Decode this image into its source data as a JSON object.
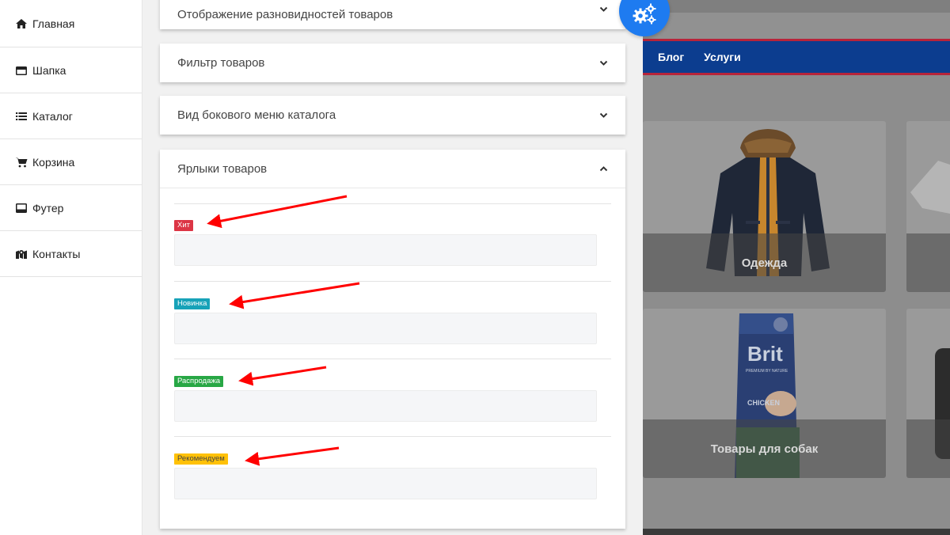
{
  "sidebar": {
    "items": [
      {
        "label": "Главная",
        "icon": "home-icon"
      },
      {
        "label": "Шапка",
        "icon": "window-icon"
      },
      {
        "label": "Каталог",
        "icon": "list-icon"
      },
      {
        "label": "Корзина",
        "icon": "cart-icon"
      },
      {
        "label": "Футер",
        "icon": "footer-icon"
      },
      {
        "label": "Контакты",
        "icon": "map-icon"
      }
    ]
  },
  "settings": {
    "sections": [
      {
        "title": "Отображение разновидностей товаров",
        "expanded": false
      },
      {
        "title": "Фильтр товаров",
        "expanded": false
      },
      {
        "title": "Вид бокового меню каталога",
        "expanded": false
      },
      {
        "title": "Ярлыки товаров",
        "expanded": true
      }
    ],
    "labels": [
      {
        "text": "Хит",
        "color": "#dc3545",
        "value": ""
      },
      {
        "text": "Новинка",
        "color": "#17a2b8",
        "value": ""
      },
      {
        "text": "Распродажа",
        "color": "#28a745",
        "value": ""
      },
      {
        "text": "Рекомендуем",
        "color": "#ffc107",
        "value": ""
      }
    ]
  },
  "preview": {
    "nav": [
      "Блог",
      "Услуги"
    ],
    "cards": [
      {
        "caption": "Одежда"
      },
      {
        "caption": "Товары для собак"
      }
    ],
    "brand_text": "Brit",
    "brand_sub": "PREMIUM BY NATURE",
    "product_text": "CHICKEN"
  },
  "colors": {
    "accent": "#1e7bf0",
    "nav_bg": "#0c3d8f",
    "nav_border": "#b8243a",
    "arrow": "#ff0000"
  }
}
